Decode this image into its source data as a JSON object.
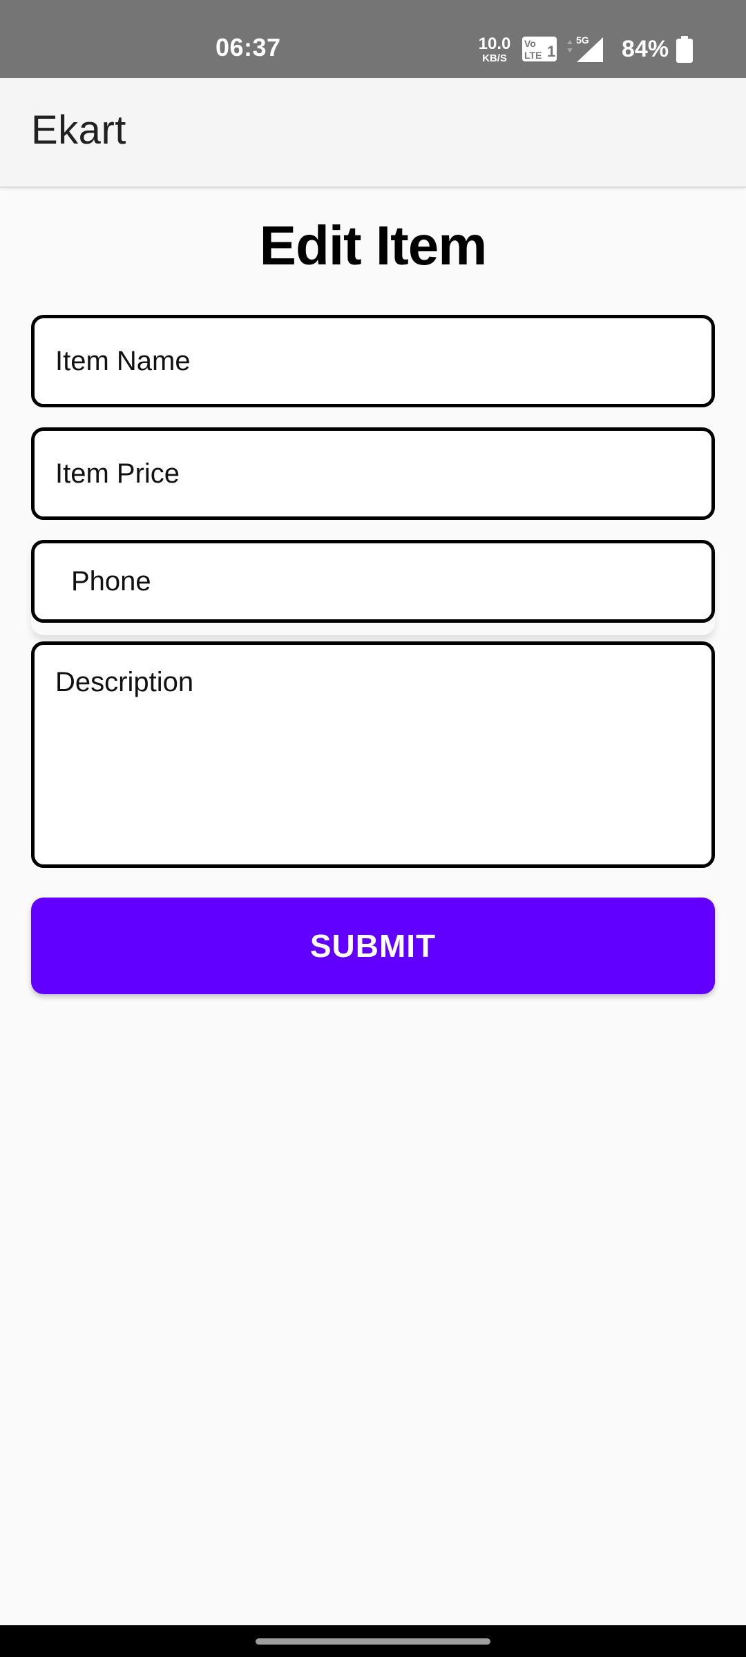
{
  "status_bar": {
    "time": "06:37",
    "net_speed_value": "10.0",
    "net_speed_unit": "KB/S",
    "network_type": "5G",
    "battery": "84%",
    "icons": [
      "volte-icon",
      "signal-5g-icon",
      "battery-icon"
    ]
  },
  "app_bar": {
    "title": "Ekart"
  },
  "form": {
    "heading": "Edit Item",
    "item_name_placeholder": "Item Name",
    "item_price_placeholder": "Item Price",
    "phone_placeholder": "Phone",
    "description_placeholder": "Description",
    "submit_label": "SUBMIT"
  },
  "colors": {
    "accent": "#6200ff",
    "status_bar": "#757575",
    "app_bar": "#f5f5f5",
    "background": "#fafafa"
  }
}
